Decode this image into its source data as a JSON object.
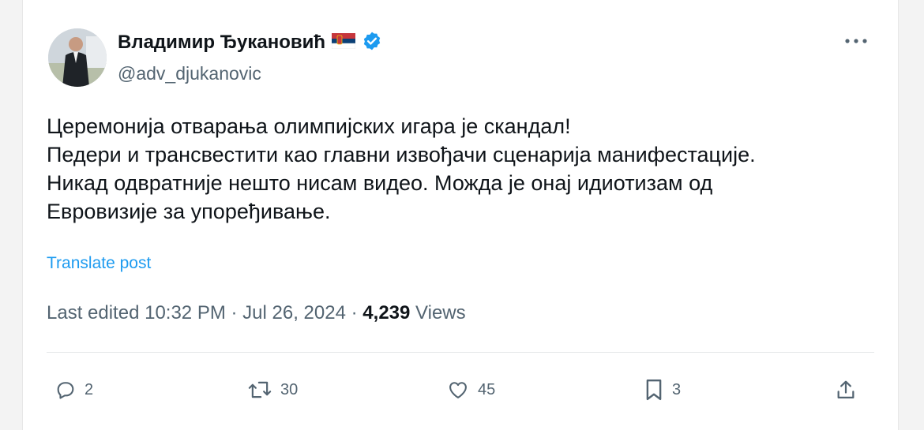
{
  "author": {
    "display_name": "Владимир Ђукановић",
    "handle": "@adv_djukanovic",
    "avatar_icon": "avatar-photo",
    "flag_icon": "serbia-flag-icon",
    "verified_icon": "verified-badge-icon",
    "verified_color": "#1d9bf0"
  },
  "post": {
    "lines": [
      "Церемонија отварања олимпијских игара је скандал!",
      "Педери и трансвестити као главни извођачи сценарија манифестације.",
      "Никад одвратније нешто нисам видео. Можда је онај идиотизам од",
      "Евровизије за упоређивање."
    ],
    "translate_label": "Translate post"
  },
  "meta": {
    "edited_prefix": "Last edited",
    "time": "10:32 PM",
    "separator": "·",
    "date": "Jul 26, 2024",
    "views_count": "4,239",
    "views_label": "Views"
  },
  "actions": {
    "replies": "2",
    "reposts": "30",
    "likes": "45",
    "bookmarks": "3"
  },
  "colors": {
    "text": "#0f1419",
    "secondary": "#536471",
    "link": "#1d9bf0"
  }
}
